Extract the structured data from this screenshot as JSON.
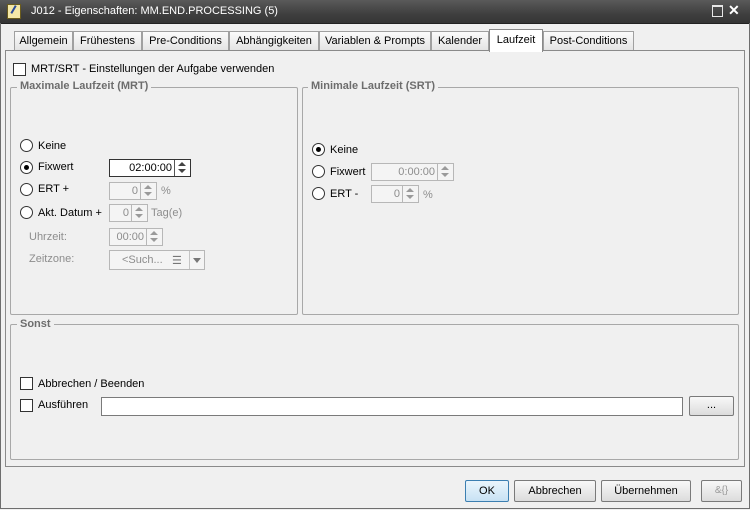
{
  "window": {
    "title": "J012 - Eigenschaften: MM.END.PROCESSING (5)"
  },
  "tabs": [
    {
      "label": "Allgemein"
    },
    {
      "label": "Frühestens"
    },
    {
      "label": "Pre-Conditions"
    },
    {
      "label": "Abhängigkeiten"
    },
    {
      "label": "Variablen & Prompts"
    },
    {
      "label": "Kalender"
    },
    {
      "label": "Laufzeit",
      "active": true
    },
    {
      "label": "Post-Conditions"
    }
  ],
  "use_task_settings": {
    "label": "MRT/SRT - Einstellungen der Aufgabe verwenden",
    "checked": false
  },
  "mrt": {
    "title": "Maximale Laufzeit (MRT)",
    "selected": "Fixwert",
    "options": {
      "keine": "Keine",
      "fixwert": "Fixwert",
      "ert": "ERT +",
      "akt_datum": "Akt. Datum +"
    },
    "fixwert_value": "02:00:00",
    "ert_value": "0",
    "ert_unit": "%",
    "akt_datum_value": "0",
    "akt_datum_unit": "Tag(e)",
    "uhrzeit_label": "Uhrzeit:",
    "uhrzeit_value": "00:00",
    "zeitzone_label": "Zeitzone:",
    "zeitzone_value": "<Such..."
  },
  "srt": {
    "title": "Minimale Laufzeit (SRT)",
    "selected": "Keine",
    "options": {
      "keine": "Keine",
      "fixwert": "Fixwert",
      "ert": "ERT -"
    },
    "fixwert_value": "0:00:00",
    "ert_value": "0",
    "ert_unit": "%"
  },
  "sonst": {
    "title": "Sonst",
    "abbrechen_label": "Abbrechen / Beenden",
    "ausfuehren_label": "Ausführen",
    "ausfuehren_value": "",
    "browse_label": "..."
  },
  "footer": {
    "ok": "OK",
    "cancel": "Abbrechen",
    "apply": "Übernehmen"
  },
  "colors": {
    "titlebar": "#3f3f3f",
    "legend": "#6d6d6d",
    "ok_border": "#3c7fb1"
  }
}
